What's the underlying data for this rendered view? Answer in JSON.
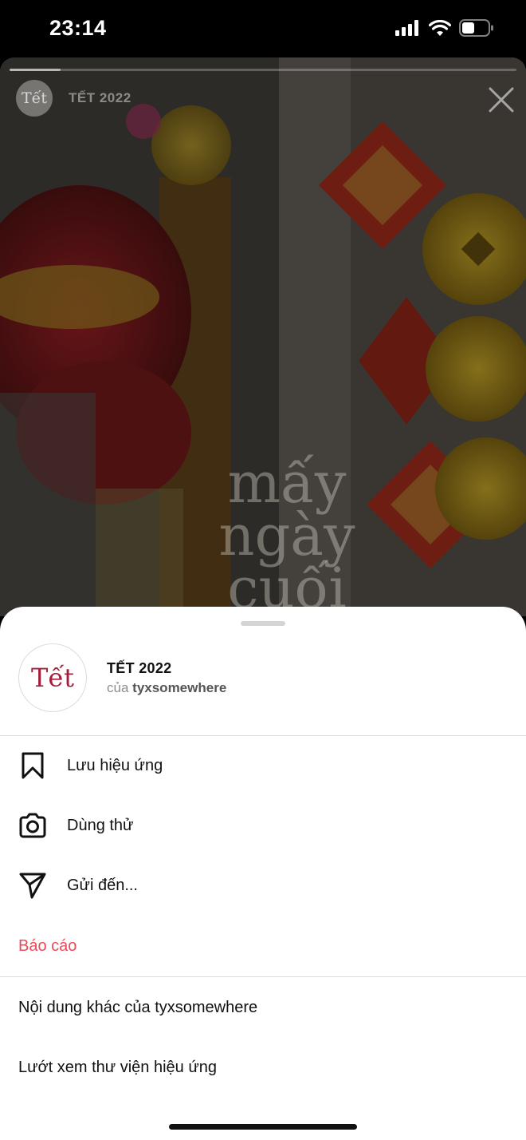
{
  "status_bar": {
    "time": "23:14"
  },
  "story": {
    "avatar_text": "Tết",
    "title": "TẾT 2022",
    "overlay_text": [
      "mấy",
      "ngày",
      "cuối"
    ],
    "progress": 0.1
  },
  "sheet": {
    "effect": {
      "avatar_text": "Tết",
      "name": "TẾT 2022",
      "by_prefix": "của",
      "author": "tyxsomewhere"
    },
    "menu": {
      "save": "Lưu hiệu ứng",
      "try": "Dùng thử",
      "send": "Gửi đến...",
      "report": "Báo cáo",
      "more_from": "Nội dung khác của tyxsomewhere",
      "browse": "Lướt xem thư viện hiệu ứng"
    }
  },
  "colors": {
    "danger": "#ed4956",
    "accent_brand": "#a51d3a"
  },
  "icons": {
    "save": "bookmark-icon",
    "try": "camera-icon",
    "send": "paper-plane-icon",
    "close": "close-icon"
  }
}
